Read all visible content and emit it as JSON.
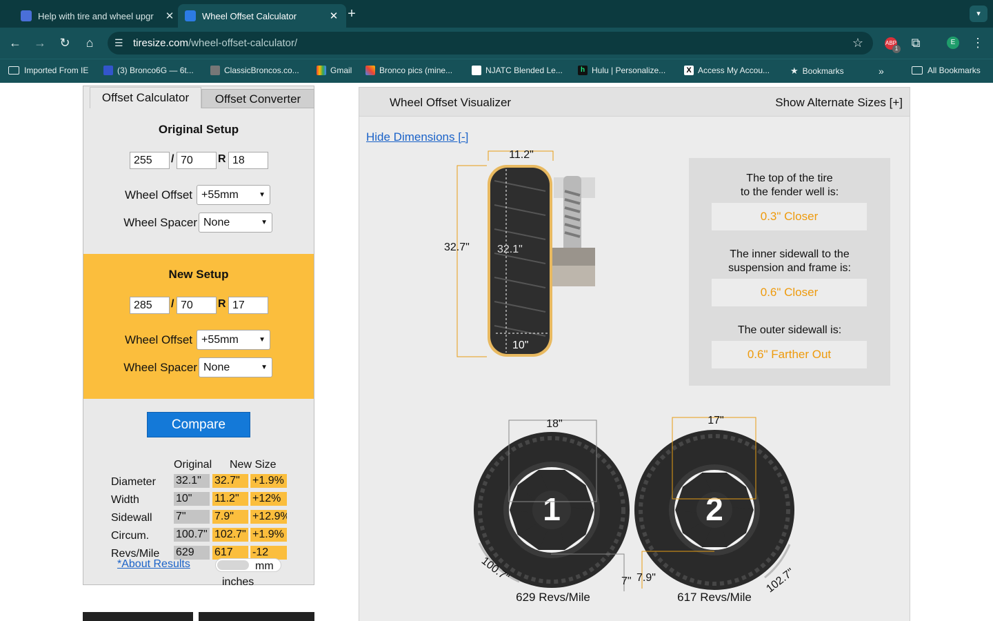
{
  "browser": {
    "tabs": [
      {
        "title": "Help with tire and wheel upgr",
        "active": false
      },
      {
        "title": "Wheel Offset Calculator",
        "active": true
      }
    ],
    "new_tab": "+",
    "tab_menu": "⌄",
    "url_domain": "tiresize.com",
    "url_path": "/wheel-offset-calculator/",
    "ext_badge": "1",
    "ext_label": "ABP",
    "avatar_letter": "E",
    "bookmarks": [
      "Imported From IE",
      "(3) Bronco6G — 6t...",
      "ClassicBroncos.co...",
      "Gmail",
      "Bronco pics (mine...",
      "NJATC Blended Le...",
      "Hulu | Personalize...",
      "Access My Accou...",
      "Bookmarks"
    ],
    "bookmarks_more": "»",
    "all_bookmarks": "All Bookmarks"
  },
  "calculator": {
    "tab_calc": "Offset Calculator",
    "tab_conv": "Offset Converter",
    "original": {
      "title": "Original Setup",
      "width": "255",
      "aspect": "70",
      "rim": "18",
      "offset_label": "Wheel Offset",
      "offset_value": "+55mm",
      "spacer_label": "Wheel Spacer",
      "spacer_value": "None"
    },
    "new": {
      "title": "New Setup",
      "width": "285",
      "aspect": "70",
      "rim": "17",
      "offset_label": "Wheel Offset",
      "offset_value": "+55mm",
      "spacer_label": "Wheel Spacer",
      "spacer_value": "None"
    },
    "sep_slash": "/",
    "sep_r": "R",
    "compare_label": "Compare",
    "results": {
      "head_original": "Original",
      "head_new": "New Size",
      "rows": [
        {
          "label": "Diameter",
          "original": "32.1\"",
          "new": "32.7\"",
          "diff": "+1.9%"
        },
        {
          "label": "Width",
          "original": "10\"",
          "new": "11.2\"",
          "diff": "+12%"
        },
        {
          "label": "Sidewall",
          "original": "7\"",
          "new": "7.9\"",
          "diff": "+12.9%"
        },
        {
          "label": "Circum.",
          "original": "100.7\"",
          "new": "102.7\"",
          "diff": "+1.9%"
        },
        {
          "label": "Revs/Mile",
          "original": "629",
          "new": "617",
          "diff": "-12"
        }
      ]
    },
    "about_link": "*About Results",
    "unit_mm": "mm",
    "unit_inches": "inches"
  },
  "visualizer": {
    "title": "Wheel Offset Visualizer",
    "alt_sizes": "Show Alternate Sizes [+]",
    "hide_dims": "Hide Dimensions [-]",
    "side_width": "11.2\"",
    "side_outer_dia": "32.7\"",
    "side_inner_dia": "32.1\"",
    "side_inner_width": "10\"",
    "info": [
      {
        "text1": "The top of the tire",
        "text2": "to the fender well is:",
        "value": "0.3\" Closer"
      },
      {
        "text1": "The inner sidewall to the",
        "text2": "suspension and frame is:",
        "value": "0.6\" Closer"
      },
      {
        "text1": "The outer sidewall is:",
        "text2": "",
        "value": "0.6\" Farther Out"
      }
    ],
    "wheel1": {
      "number": "1",
      "rim": "18\"",
      "sidewall": "7\"",
      "circ": "100.7\"",
      "revs": "629 Revs/Mile"
    },
    "wheel2": {
      "number": "2",
      "rim": "17\"",
      "sidewall": "7.9\"",
      "circ": "102.7\"",
      "revs": "617 Revs/Mile"
    }
  },
  "colors": {
    "accent_orange": "#fbbe3d",
    "value_orange": "#ee9a0c",
    "button_blue": "#1479d8",
    "browser_dark": "#0c3a3f",
    "browser_mid": "#165158"
  }
}
